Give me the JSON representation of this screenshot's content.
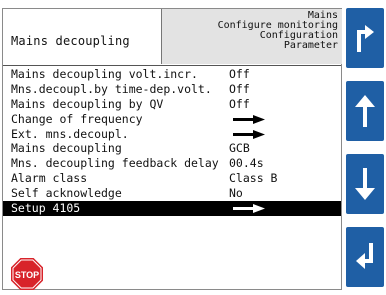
{
  "header": {
    "title": "Mains decoupling",
    "breadcrumb": [
      "Mains",
      "Configure monitoring",
      "Configuration",
      "Parameter"
    ]
  },
  "rows": [
    {
      "label": "Mains decoupling volt.incr.",
      "value": "Off",
      "arrow": false
    },
    {
      "label": "Mns.decoupl.by time-dep.volt.",
      "value": "Off",
      "arrow": false
    },
    {
      "label": "Mains decoupling by QV",
      "value": "Off",
      "arrow": false
    },
    {
      "label": "Change of frequency",
      "value": "",
      "arrow": true
    },
    {
      "label": "Ext. mns.decoupl.",
      "value": "",
      "arrow": true
    },
    {
      "label": "Mains decoupling",
      "value": "GCB",
      "arrow": false
    },
    {
      "label": "Mns. decoupling feedback delay",
      "value": "00.4s",
      "arrow": false
    },
    {
      "label": "Alarm class",
      "value": "Class B",
      "arrow": false
    },
    {
      "label": "Self acknowledge",
      "value": "No",
      "arrow": false
    },
    {
      "label": "Setup 4105",
      "value": "",
      "arrow": true,
      "selected": true
    }
  ],
  "stop_label": "STOP",
  "colors": {
    "button_blue": "#1f5fa5",
    "stop_red": "#d8232a",
    "header_grey": "#e3e3e3"
  },
  "icons": [
    "back-up-icon",
    "arrow-up-icon",
    "arrow-down-icon",
    "enter-icon",
    "stop-icon"
  ]
}
